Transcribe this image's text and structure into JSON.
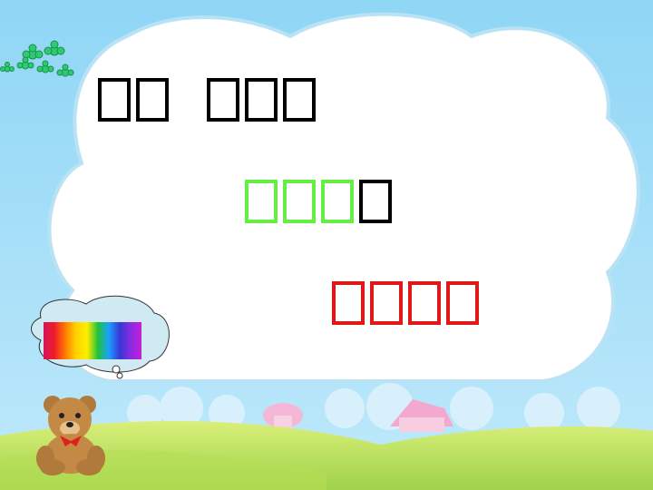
{
  "slide": {
    "lines": [
      {
        "color": "#000000",
        "groups": [
          2,
          3
        ]
      },
      {
        "color": "#66ee44",
        "groups": [
          3
        ],
        "trailing_black": 1
      },
      {
        "color": "#e01818",
        "groups": [
          4
        ]
      }
    ]
  },
  "colors": {
    "sky": "#8fd6f5",
    "cloud": "#ffffff",
    "grass": "#c6e86a"
  },
  "icons": [
    "clover-icon",
    "rainbow-swatch",
    "teddy-bear-icon",
    "mushroom-house-icon"
  ]
}
